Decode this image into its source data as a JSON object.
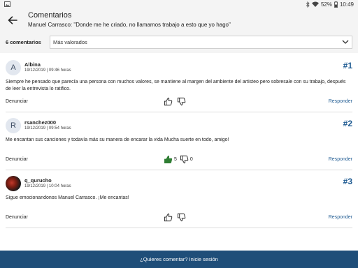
{
  "status": {
    "battery": "52%",
    "time": "10:49"
  },
  "header": {
    "title": "Comentarios",
    "subtitle": "Manuel Carrasco: \"Donde me he criado, no llamamos trabajo a esto que yo hago\""
  },
  "sort": {
    "count_label": "6 comentarios",
    "selected": "Más valorados"
  },
  "comments": [
    {
      "avatar_letter": "A",
      "author": "Albina",
      "date": "19/12/2019 | 09:46 horas",
      "rank": "#1",
      "text": "Siempre he pensado que parecía una persona con muchos valores, se mantiene al margen del ambiente del artisteo pero sobresale con su trabajo, después de leer la entrevista lo ratifico.",
      "report": "Denunciar",
      "reply": "Responder",
      "likes": "",
      "dislikes": ""
    },
    {
      "avatar_letter": "R",
      "author": "rsanchez000",
      "date": "19/12/2019 | 09:54 horas",
      "rank": "#2",
      "text": "Me encantan sus canciones y todavía más su manera de encarar la vida Mucha suerte en todo, amigo!",
      "report": "Denunciar",
      "reply": "Responder",
      "likes": "5",
      "dislikes": "0"
    },
    {
      "avatar_letter": "",
      "author": "q_qurucho",
      "date": "19/12/2019 | 10:04 horas",
      "rank": "#3",
      "text": "Sigue emocionandonos Manuel Carrasco. ¡Me encantas!",
      "report": "Denunciar",
      "reply": "Responder",
      "likes": "",
      "dislikes": ""
    }
  ],
  "footer": {
    "cta": "¿Quieres comentar? Inicie sesión"
  },
  "colors": {
    "accent": "#1f5b92",
    "footer_bg": "#1f4e79",
    "like_active": "#2e7d32"
  }
}
